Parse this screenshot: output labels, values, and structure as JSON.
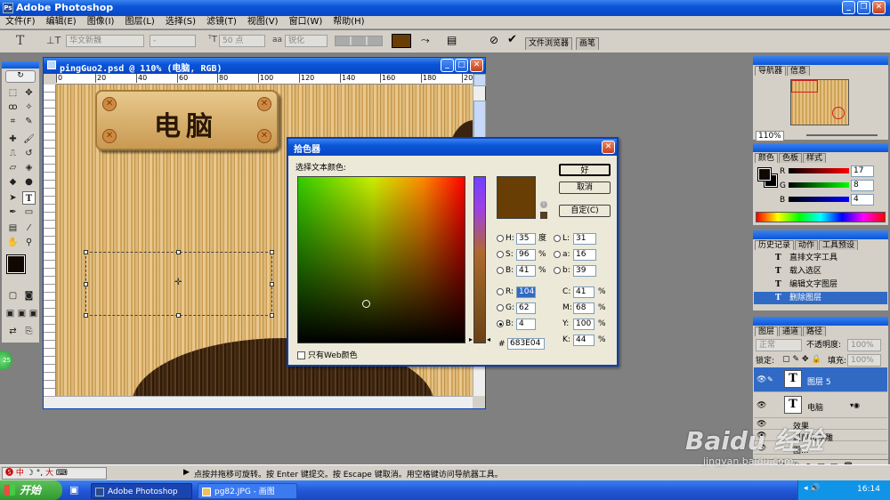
{
  "app": {
    "title": "Adobe Photoshop"
  },
  "menu": [
    "文件(F)",
    "编辑(E)",
    "图像(I)",
    "图层(L)",
    "选择(S)",
    "滤镜(T)",
    "视图(V)",
    "窗口(W)",
    "帮助(H)"
  ],
  "options": {
    "font_family": "华文新魏",
    "font_style": "-",
    "font_size": "50 点",
    "aa_label": "aa",
    "aa_mode": "锐化",
    "text_color": "#683E04",
    "tab_file_browser": "文件浏览器",
    "tab_brushes": "画笔"
  },
  "document": {
    "title": "pingGuo2.psd @ 110% (电脑, RGB)",
    "sign_text": "电脑",
    "ruler_labels": [
      "0",
      "20",
      "40",
      "60",
      "80",
      "100",
      "120",
      "140",
      "160",
      "180",
      "200"
    ]
  },
  "color_picker": {
    "title": "拾色器",
    "prompt": "选择文本颜色:",
    "ok": "好",
    "cancel": "取消",
    "custom": "自定(C)",
    "hex_label": "#",
    "web_only": "只有Web颜色",
    "hex": "683E04",
    "fields": {
      "H": "35",
      "H_unit": "度",
      "S": "96",
      "S_unit": "%",
      "Bv": "41",
      "Bv_unit": "%",
      "R": "104",
      "G": "62",
      "B": "4",
      "L": "31",
      "a": "16",
      "b": "39",
      "C": "41",
      "M": "68",
      "Y": "100",
      "K": "44",
      "pct": "%"
    },
    "labels": {
      "H": "H:",
      "S": "S:",
      "Bv": "B:",
      "L": "L:",
      "a": "a:",
      "b": "b:",
      "R": "R:",
      "G": "G:",
      "B": "B:",
      "C": "C:",
      "M": "M:",
      "Y": "Y:",
      "K": "K:"
    }
  },
  "navigator": {
    "tabs": [
      "导航器",
      "信息"
    ],
    "zoom": "110%"
  },
  "color_panel": {
    "tabs": [
      "颜色",
      "色板",
      "样式"
    ],
    "R": "17",
    "G": "8",
    "B": "4",
    "labels": {
      "R": "R",
      "G": "G",
      "B": "B"
    }
  },
  "history": {
    "tabs": [
      "历史记录",
      "动作",
      "工具预设"
    ],
    "items": [
      "直排文字工具",
      "载入选区",
      "编辑文字图层",
      "删除图层"
    ]
  },
  "layers": {
    "tabs": [
      "图层",
      "通道",
      "路径"
    ],
    "blend_mode": "正常",
    "opacity_label": "不透明度:",
    "opacity": "100%",
    "lock_label": "锁定:",
    "fill_label": "填充:",
    "fill": "100%",
    "items": [
      {
        "name": "图层 5"
      },
      {
        "name": "电脑"
      }
    ],
    "effects": "效果",
    "effect_item": "斜面和浮雕",
    "extra_item": "图..."
  },
  "status": {
    "hint": "点按并拖移可旋转。按 Enter 键提交。按 Escape 键取消。用空格键访问导航器工具。",
    "ime": "中",
    "ime_mode": "大"
  },
  "taskbar": {
    "start": "开始",
    "tasks": [
      "Adobe Photoshop",
      "pg82.JPG - 画图"
    ],
    "clock": "16:14"
  },
  "watermark": {
    "text": "Baidu 经验",
    "url": "jingyan.baidu.com"
  }
}
